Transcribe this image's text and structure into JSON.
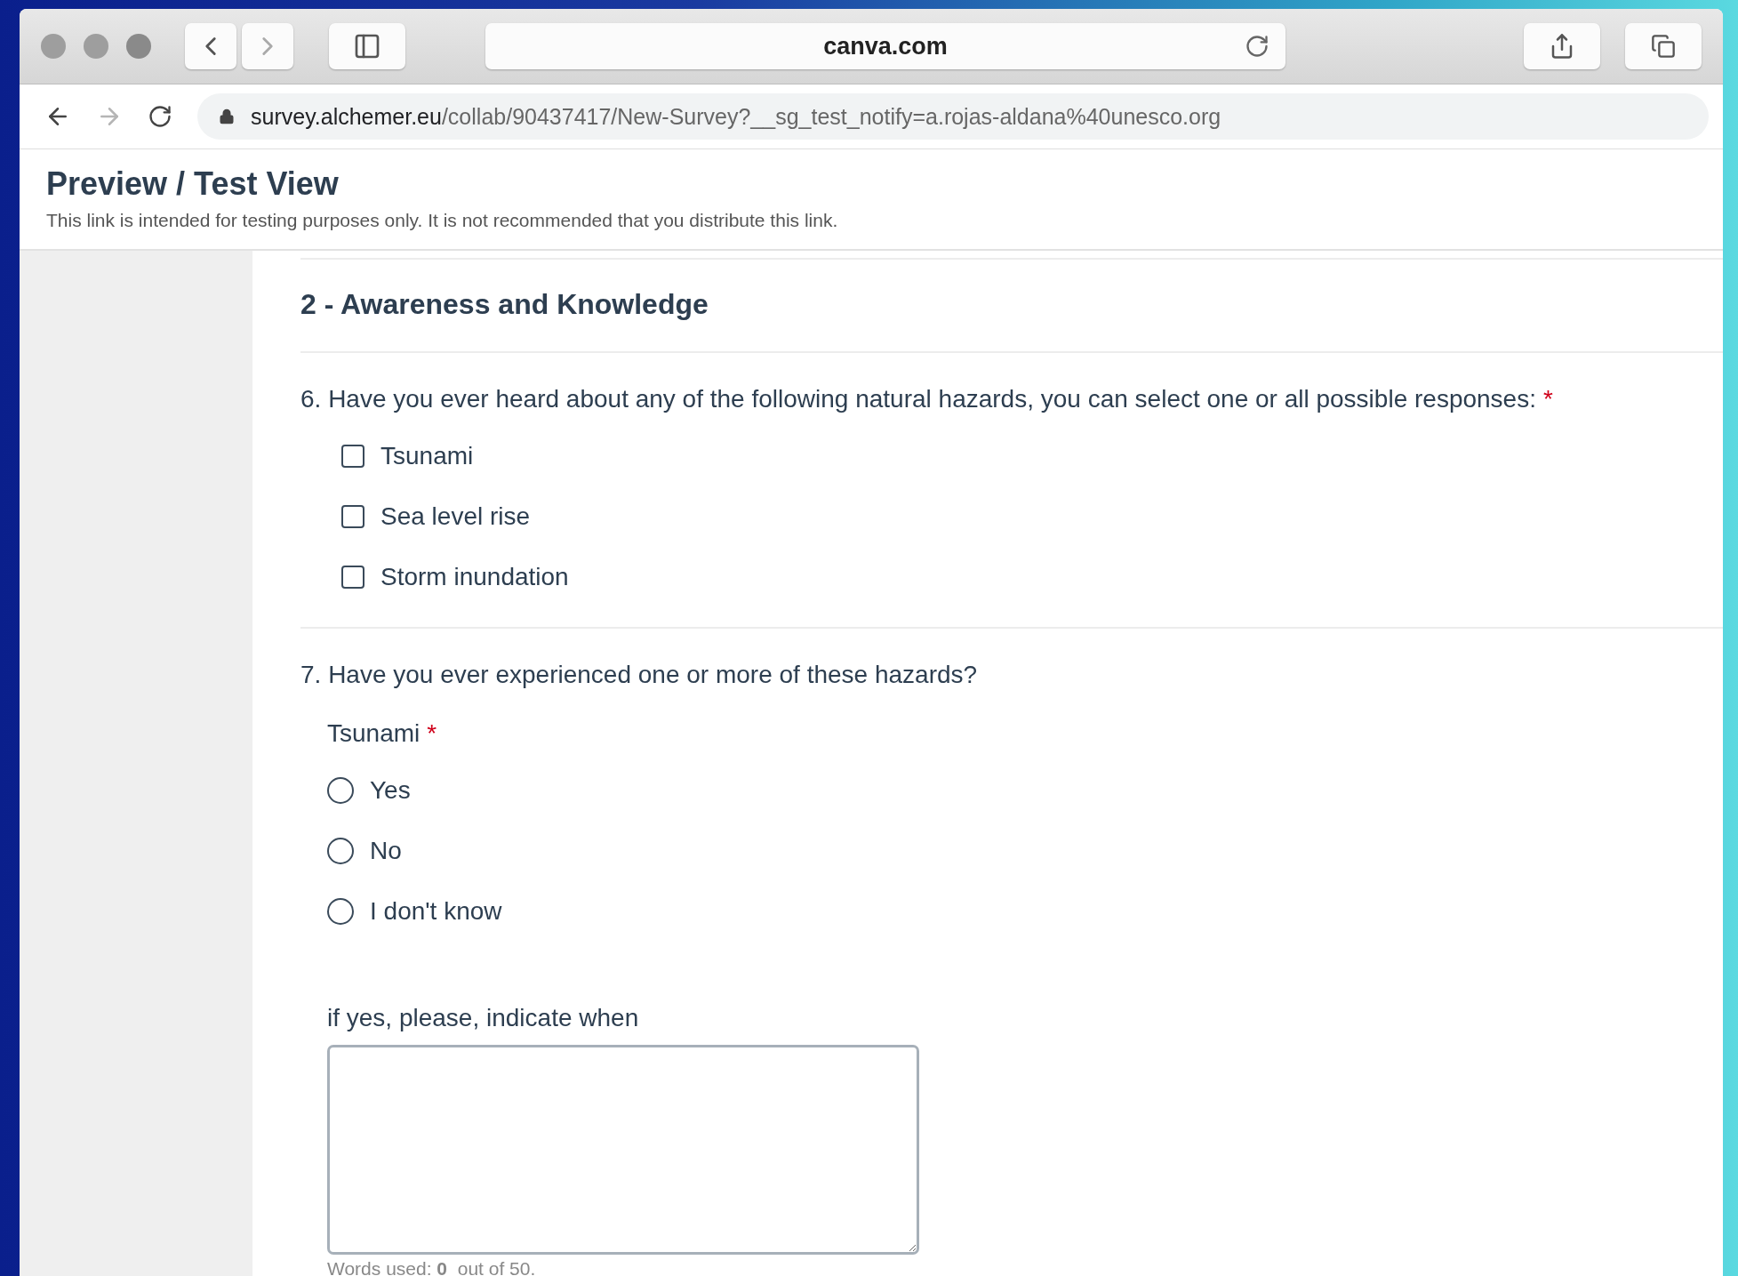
{
  "safari": {
    "address": "canva.com"
  },
  "chrome": {
    "forward_disabled": true,
    "url_host": "survey.alchemer.eu",
    "url_rest": "/collab/90437417/New-Survey?__sg_test_notify=a.rojas-aldana%40unesco.org"
  },
  "preview": {
    "title": "Preview / Test View",
    "subtitle": "This link is intended for testing purposes only. It is not recommended that you distribute this link."
  },
  "section": {
    "title": "2 - Awareness and Knowledge"
  },
  "questions": [
    {
      "kind": "checkbox",
      "text": "6. Have you ever heard about any of the following natural hazards, you can select one or all possible responses:",
      "required_mark": "*",
      "options": [
        {
          "label": "Tsunami",
          "checked": false
        },
        {
          "label": "Sea level rise",
          "checked": false
        },
        {
          "label": "Storm inundation",
          "checked": false
        }
      ]
    },
    {
      "kind": "group",
      "text": "7. Have you ever experienced one or more of these hazards?",
      "fields": [
        {
          "kind": "radio",
          "label": "Tsunami",
          "required_mark": "*",
          "options": [
            {
              "label": "Yes",
              "selected": false
            },
            {
              "label": "No",
              "selected": false
            },
            {
              "label": "I don't know",
              "selected": false
            }
          ]
        },
        {
          "kind": "textarea",
          "label": "if yes, please, indicate when",
          "counter": "Words used: **0**  out of 50."
        }
      ]
    }
  ]
}
